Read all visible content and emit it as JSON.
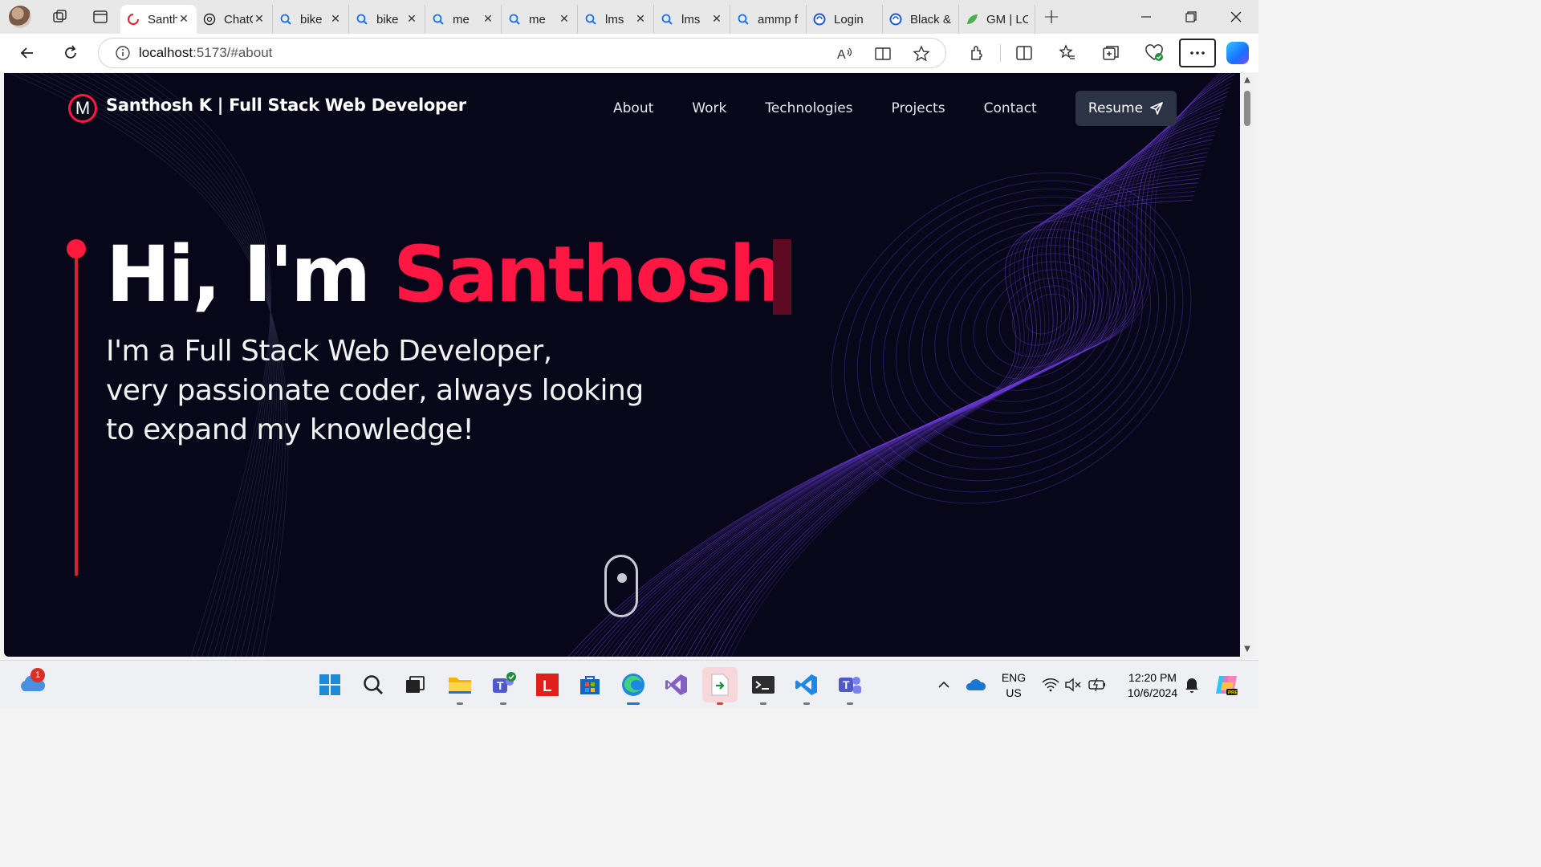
{
  "browser": {
    "tabs": [
      {
        "label": "Santhosh K",
        "icon": "loading-ring-icon",
        "active": true,
        "closable": true
      },
      {
        "label": "ChatGPT",
        "icon": "chatgpt-icon",
        "active": false,
        "closable": true
      },
      {
        "label": "bike",
        "icon": "search-icon",
        "active": false,
        "closable": true
      },
      {
        "label": "bike",
        "icon": "search-icon",
        "active": false,
        "closable": true
      },
      {
        "label": "me",
        "icon": "search-icon",
        "active": false,
        "closable": true
      },
      {
        "label": "me",
        "icon": "search-icon",
        "active": false,
        "closable": true
      },
      {
        "label": "lms",
        "icon": "search-icon",
        "active": false,
        "closable": true
      },
      {
        "label": "lms",
        "icon": "search-icon",
        "active": false,
        "closable": true
      },
      {
        "label": "ammp f",
        "icon": "search-icon",
        "active": false,
        "closable": false
      },
      {
        "label": "Login",
        "icon": "site-icon",
        "active": false,
        "closable": false
      },
      {
        "label": "Black &",
        "icon": "site-icon",
        "active": false,
        "closable": false
      },
      {
        "label": "GM | LO",
        "icon": "leaf-icon",
        "active": false,
        "closable": false
      }
    ],
    "url_host": "localhost",
    "url_rest": ":5173/#about"
  },
  "site": {
    "title": "Santhosh K  | Full Stack Web Developer",
    "logo_letter": "M",
    "nav": [
      "About",
      "Work",
      "Technologies",
      "Projects",
      "Contact"
    ],
    "resume_label": "Resume",
    "hero_prefix": "Hi, I'm ",
    "hero_name": "Santhosh",
    "hero_sub_lines": [
      "I'm a Full Stack Web Developer,",
      "very passionate coder, always looking",
      "to expand my knowledge!"
    ],
    "colors": {
      "accent": "#ff1744",
      "background": "#070719",
      "wave": "#6a3bd6"
    }
  },
  "taskbar": {
    "weather_badge": "1",
    "lang_top": "ENG",
    "lang_bottom": "US",
    "time": "12:20 PM",
    "date": "10/6/2024",
    "pinned": [
      "windows-start",
      "search",
      "task-view",
      "file-explorer",
      "teams",
      "lexis",
      "store",
      "edge",
      "visual-studio",
      "app-installer",
      "terminal",
      "vscode",
      "teams-work"
    ]
  }
}
